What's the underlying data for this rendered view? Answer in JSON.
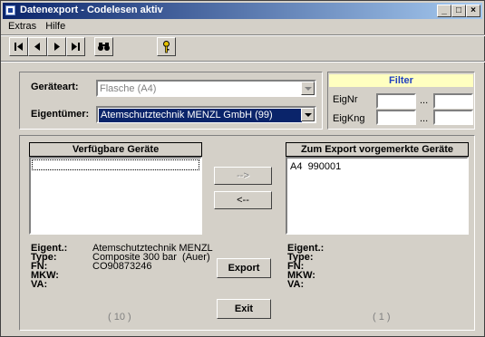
{
  "window": {
    "title": "Datenexport - Codelesen aktiv"
  },
  "menu": [
    "Extras",
    "Hilfe"
  ],
  "toolbar": {
    "buttons": [
      "first-icon",
      "prev-icon",
      "next-icon",
      "last-icon",
      "binoculars-icon",
      "key-icon"
    ]
  },
  "form": {
    "geraeteart_label": "Geräteart:",
    "geraeteart_value": "Flasche (A4)",
    "eigentuemer_label": "Eigentümer:",
    "eigentuemer_value": "Atemschutztechnik MENZL GmbH  (99)"
  },
  "filter": {
    "title": "Filter",
    "eignr_label": "EigNr",
    "eigkng_label": "EigKng",
    "range_sep": "..."
  },
  "left_list": {
    "header": "Verfügbare Geräte",
    "items": [
      ""
    ],
    "count": "( 10 )"
  },
  "right_list": {
    "header": "Zum Export vorgemerkte Geräte",
    "items": [
      "A4  990001"
    ],
    "count": "( 1 )"
  },
  "buttons": {
    "add": "-->",
    "remove": "<--",
    "export": "Export",
    "exit": "Exit"
  },
  "left_details": {
    "labels": [
      "Eigent.:",
      "Type:",
      "FN:",
      "MKW:",
      "VA:"
    ],
    "values": [
      "Atemschutztechnik MENZL",
      "Composite 300 bar  (Auer)",
      "CO90873246",
      "",
      ""
    ]
  },
  "right_details": {
    "labels": [
      "Eigent.:",
      "Type:",
      "FN:",
      "MKW:",
      "VA:"
    ]
  },
  "colors": {
    "titlebar_start": "#0a246a",
    "titlebar_end": "#a6caf0",
    "filter_header": "#ffffc0",
    "selection": "#0a246a"
  }
}
